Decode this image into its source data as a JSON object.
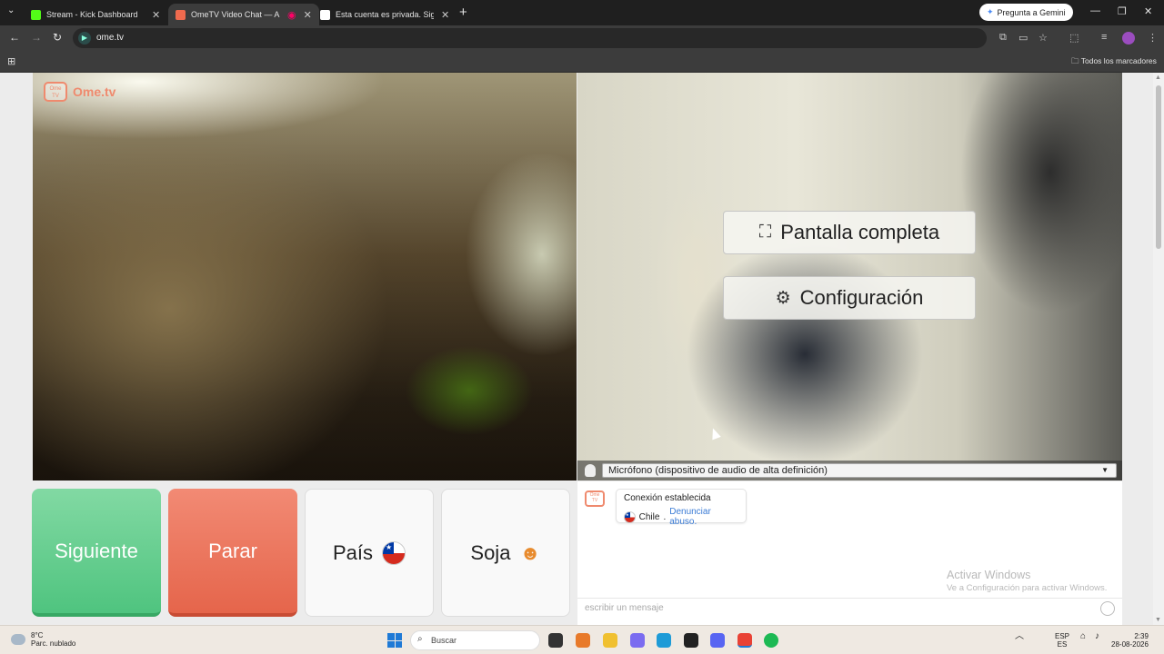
{
  "browser": {
    "tabs": [
      {
        "title": "Stream - Kick Dashboard",
        "favicon_color": "#53fc18"
      },
      {
        "title": "OmeTV Video Chat — Alter",
        "favicon_color": "#ef6a4e"
      },
      {
        "title": "Esta cuenta es privada. Sigue a",
        "favicon_color": "#222222"
      }
    ],
    "gemini_label": "Pregunta a Gemini",
    "url": "ome.tv",
    "bookmarks_all": "Todos los marcadores"
  },
  "page": {
    "logo_small": "Ome TV",
    "logo_text": "Ome.tv",
    "overlay": {
      "fullscreen_label": "Pantalla completa",
      "settings_label": "Configuración"
    },
    "mic_select_value": "Micrófono (dispositivo de audio de alta definición)",
    "controls": {
      "next_label": "Siguiente",
      "stop_label": "Parar",
      "country_label": "País",
      "gender_label": "Soja"
    },
    "chat": {
      "message_title": "Conexión establecida",
      "country": "Chile",
      "separator": ".",
      "report_link": "Denunciar abuso.",
      "watermark_line1": "Activar Windows",
      "watermark_line2": "Ve a Configuración para activar Windows.",
      "input_placeholder": "escribir un mensaje"
    }
  },
  "taskbar": {
    "weather_temp": "8°C",
    "weather_desc": "Parc. nublado",
    "search_label": "Buscar",
    "lang_top": "ESP",
    "lang_bottom": "ES",
    "time": "2:39",
    "date": "28-08-2026"
  },
  "colors": {
    "next": "#4fc47f",
    "stop": "#e5654b",
    "brand": "#ef8a6e",
    "link": "#3a7bd5"
  }
}
